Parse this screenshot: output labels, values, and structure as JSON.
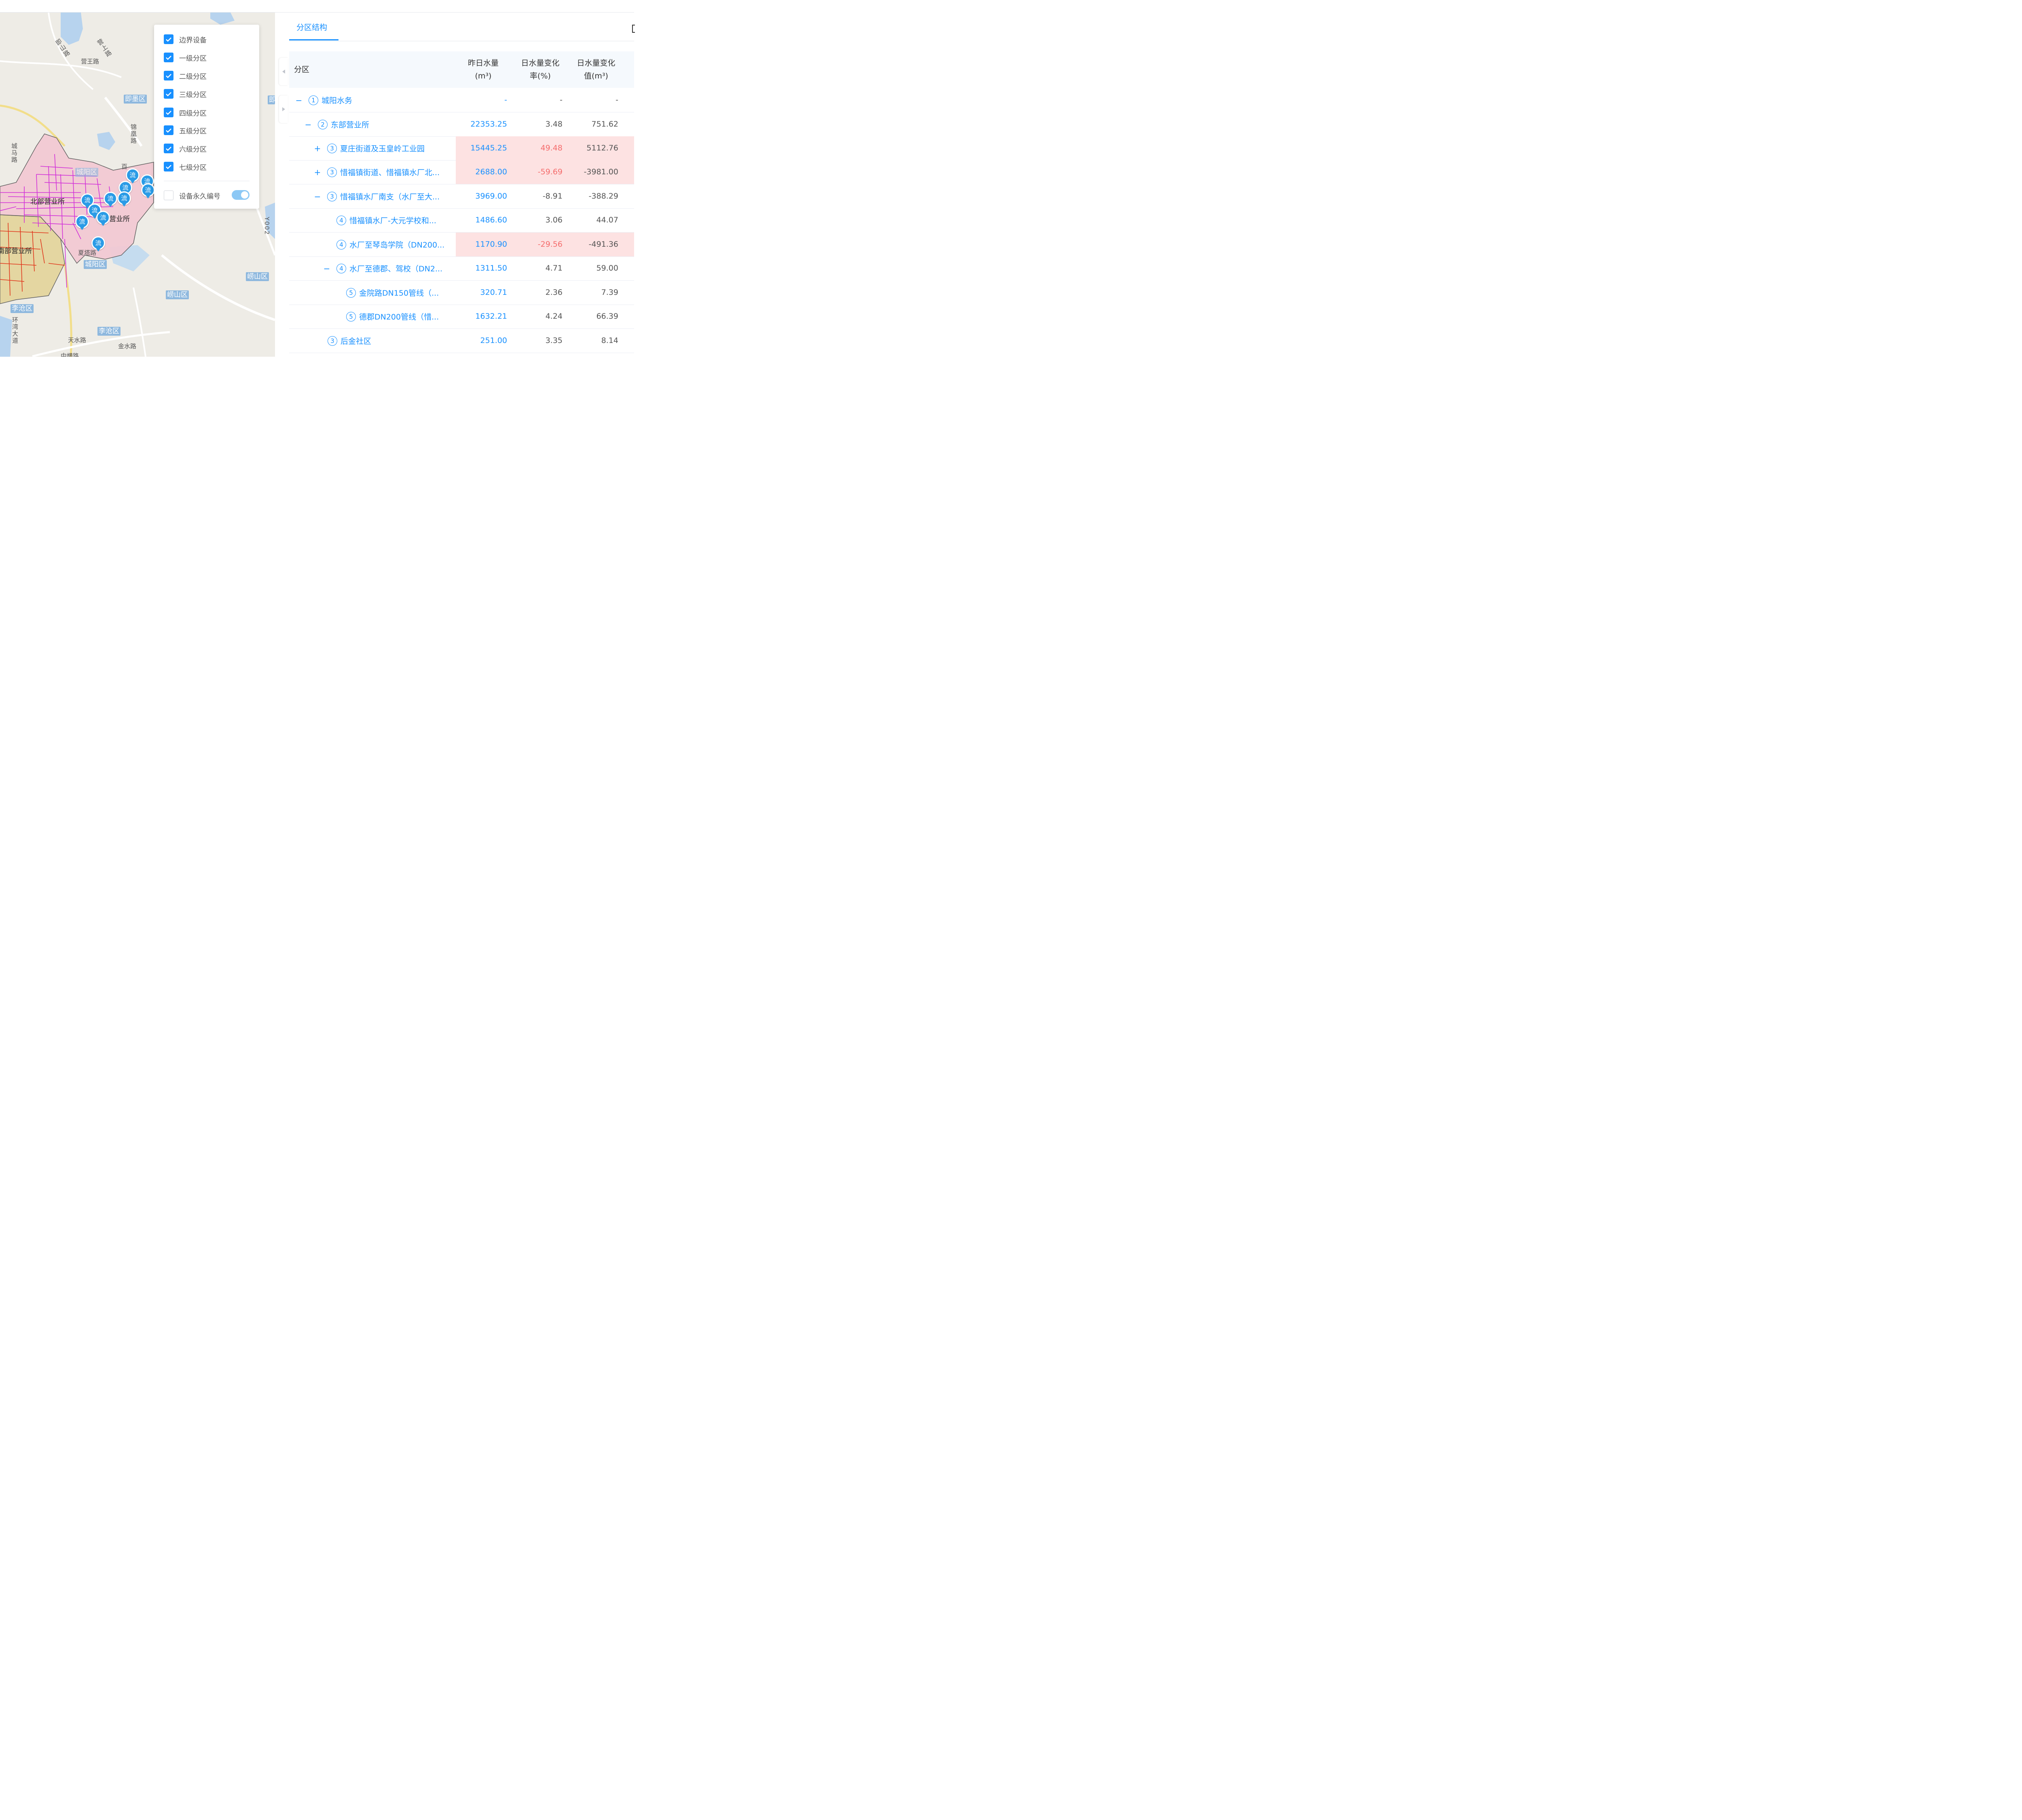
{
  "map": {
    "road_labels": [
      "营王路",
      "营上路",
      "即山路",
      "锦凰路",
      "城马路",
      "夏塔路",
      "天水路",
      "金水路",
      "环湾大道",
      "中横路",
      "Y002",
      "百"
    ],
    "district_badges": [
      "即墨区",
      "即墨区",
      "崂山区",
      "崂山区",
      "城阳区",
      "李沧区",
      "李沧区",
      "城阳区"
    ],
    "office_labels": [
      "北部营业所",
      "营业所",
      "南部营业所"
    ],
    "marker_text": "流",
    "colors": {
      "zone_pink": "#f3c9d3",
      "zone_olive": "#e3d49a",
      "pipe_magenta": "#d22fd8",
      "pipe_red": "#e0361b",
      "marker": "#2a9be6"
    }
  },
  "layer_panel": {
    "items": [
      {
        "label": "边界设备",
        "checked": true
      },
      {
        "label": "一级分区",
        "checked": true
      },
      {
        "label": "二级分区",
        "checked": true
      },
      {
        "label": "三级分区",
        "checked": true
      },
      {
        "label": "四级分区",
        "checked": true
      },
      {
        "label": "五级分区",
        "checked": true
      },
      {
        "label": "六级分区",
        "checked": true
      },
      {
        "label": "七级分区",
        "checked": true
      }
    ],
    "permanent_id": {
      "label": "设备永久编号",
      "checked": false,
      "toggle_on": true
    }
  },
  "right_panel": {
    "tab": "分区结构",
    "columns": {
      "zone": "分区",
      "yesterday_1": "昨日水量",
      "yesterday_2": "(m³)",
      "rate_1": "日水量变化",
      "rate_2": "率(%)",
      "value_1": "日水量变化",
      "value_2": "值(m³)"
    },
    "rows": [
      {
        "expand": "−",
        "level": "1",
        "name": "城阳水务",
        "yesterday": "-",
        "rate": "-",
        "value": "-",
        "highlight": false,
        "rate_red": false
      },
      {
        "expand": "−",
        "level": "2",
        "name": "东部营业所",
        "yesterday": "22353.25",
        "rate": "3.48",
        "value": "751.62",
        "highlight": false,
        "rate_red": false
      },
      {
        "expand": "+",
        "level": "3",
        "name": "夏庄街道及玉皇岭工业园",
        "yesterday": "15445.25",
        "rate": "49.48",
        "value": "5112.76",
        "highlight": true,
        "rate_red": true
      },
      {
        "expand": "+",
        "level": "3",
        "name": "惜福镇街道、惜福镇水厂北...",
        "yesterday": "2688.00",
        "rate": "-59.69",
        "value": "-3981.00",
        "highlight": true,
        "rate_red": true
      },
      {
        "expand": "−",
        "level": "3",
        "name": "惜福镇水厂南支（水厂至大...",
        "yesterday": "3969.00",
        "rate": "-8.91",
        "value": "-388.29",
        "highlight": false,
        "rate_red": false
      },
      {
        "expand": "",
        "level": "4",
        "name": "惜福镇水厂-大元学校和...",
        "yesterday": "1486.60",
        "rate": "3.06",
        "value": "44.07",
        "highlight": false,
        "rate_red": false
      },
      {
        "expand": "",
        "level": "4",
        "name": "水厂至琴岛学院（DN200...",
        "yesterday": "1170.90",
        "rate": "-29.56",
        "value": "-491.36",
        "highlight": true,
        "rate_red": true
      },
      {
        "expand": "−",
        "level": "4",
        "name": "水厂至德郡、驾校（DN2...",
        "yesterday": "1311.50",
        "rate": "4.71",
        "value": "59.00",
        "highlight": false,
        "rate_red": false
      },
      {
        "expand": "",
        "level": "5",
        "name": "金院路DN150管线（...",
        "yesterday": "320.71",
        "rate": "2.36",
        "value": "7.39",
        "highlight": false,
        "rate_red": false
      },
      {
        "expand": "",
        "level": "5",
        "name": "德郡DN200管线（惜...",
        "yesterday": "1632.21",
        "rate": "4.24",
        "value": "66.39",
        "highlight": false,
        "rate_red": false
      },
      {
        "expand": "",
        "level": "3",
        "name": "后金社区",
        "yesterday": "251.00",
        "rate": "3.35",
        "value": "8.14",
        "highlight": false,
        "rate_red": false
      }
    ]
  }
}
